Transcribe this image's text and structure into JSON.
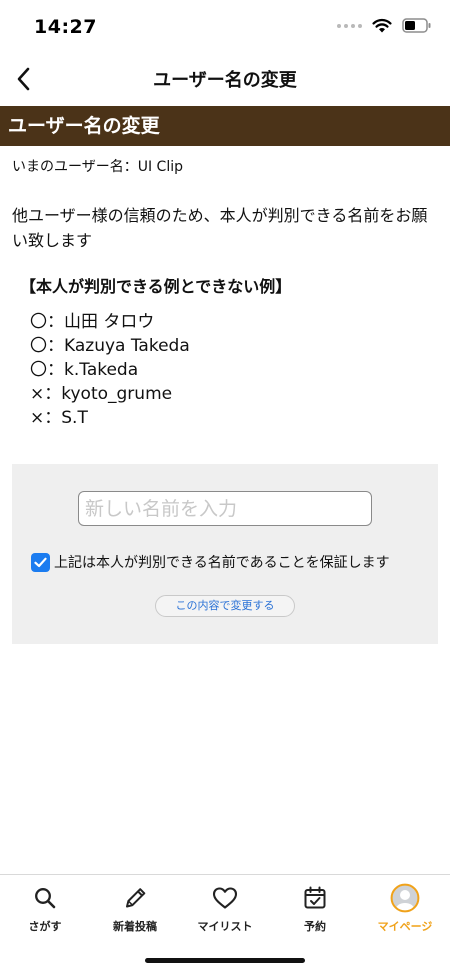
{
  "status_bar": {
    "time": "14:27"
  },
  "nav": {
    "back_icon": "chevron-left-icon",
    "title": "ユーザー名の変更"
  },
  "section": {
    "title": "ユーザー名の変更"
  },
  "current_name": {
    "text": "いまのユーザー名：UI Clip"
  },
  "description": "他ユーザー様の信頼のため、本人が判別できる名前をお願い致します",
  "examples": {
    "title": "【本人が判別できる例とできない例】",
    "items": [
      "〇：山田 タロウ",
      "〇：Kazuya Takeda",
      "〇：k.Takeda",
      "×：kyoto_grume",
      "×：S.T"
    ]
  },
  "form": {
    "input_placeholder": "新しい名前を入力",
    "input_value": "",
    "confirm_label": "上記は本人が判別できる名前であることを保証します",
    "confirm_checked": true,
    "submit_label": "この内容で変更する"
  },
  "tabs": [
    {
      "label": "さがす",
      "icon": "search-icon",
      "active": false
    },
    {
      "label": "新着投稿",
      "icon": "pencil-icon",
      "active": false
    },
    {
      "label": "マイリスト",
      "icon": "heart-icon",
      "active": false
    },
    {
      "label": "予約",
      "icon": "calendar-check-icon",
      "active": false
    },
    {
      "label": "マイページ",
      "icon": "avatar-icon",
      "active": true
    }
  ],
  "colors": {
    "section_header_bg": "#4b3318",
    "accent_active_tab": "#f0a21a",
    "checkbox": "#1b7cf0",
    "link_blue": "#2b72d6",
    "panel_bg": "#efefef"
  }
}
